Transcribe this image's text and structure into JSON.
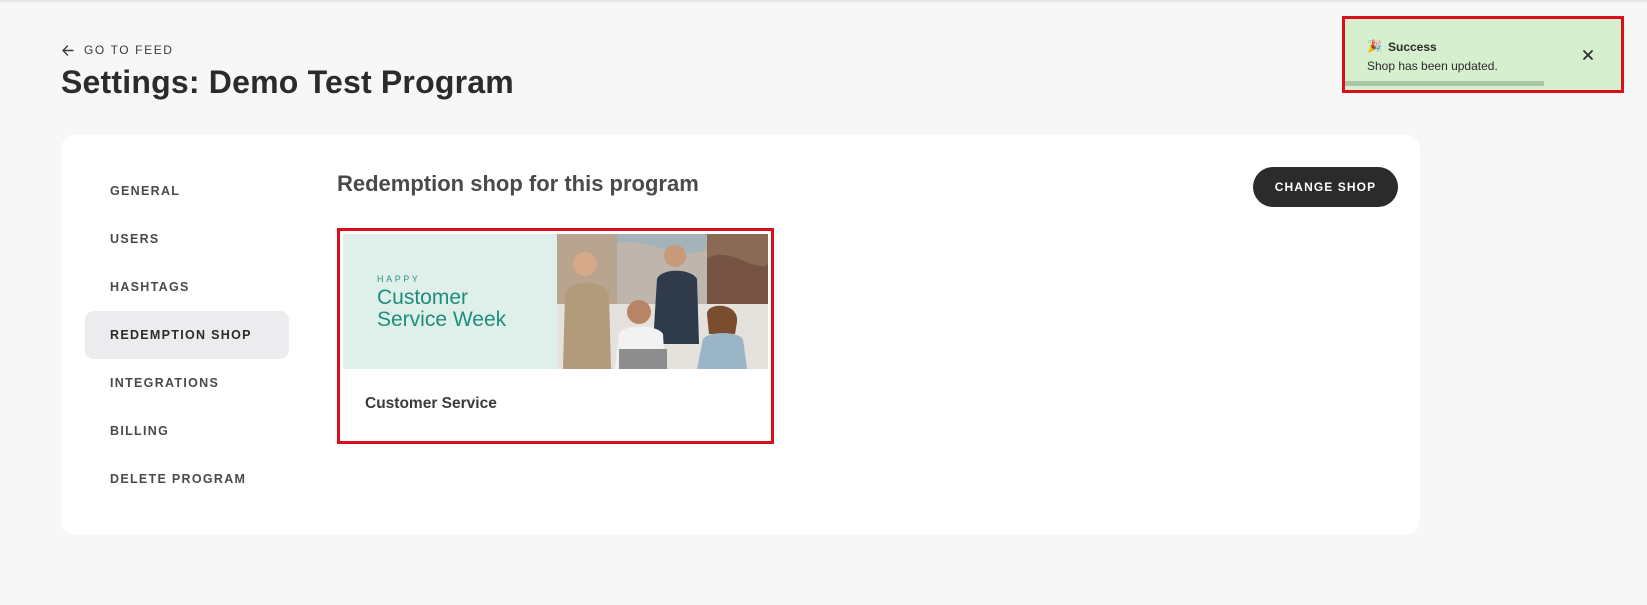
{
  "header": {
    "back_link_label": "GO TO FEED",
    "page_title": "Settings: Demo Test Program"
  },
  "sidebar": {
    "items": [
      {
        "label": "GENERAL",
        "active": false
      },
      {
        "label": "USERS",
        "active": false
      },
      {
        "label": "HASHTAGS",
        "active": false
      },
      {
        "label": "REDEMPTION SHOP",
        "active": true
      },
      {
        "label": "INTEGRATIONS",
        "active": false
      },
      {
        "label": "BILLING",
        "active": false
      },
      {
        "label": "DELETE PROGRAM",
        "active": false
      }
    ]
  },
  "main": {
    "section_title": "Redemption shop for this program",
    "change_shop_label": "CHANGE SHOP",
    "shop": {
      "banner_kicker": "HAPPY",
      "banner_line1": "Customer",
      "banner_line2": "Service Week",
      "name": "Customer Service"
    }
  },
  "toast": {
    "emoji": "🎉",
    "title": "Success",
    "message": "Shop has been updated.",
    "progress_fraction": 0.72,
    "close_icon": "close-icon"
  },
  "colors": {
    "accent_dark": "#2b2b2b",
    "highlight_border": "#d9101c",
    "toast_bg": "#d6efcf",
    "banner_bg": "#dff0ea",
    "banner_text": "#1f8d7c"
  }
}
